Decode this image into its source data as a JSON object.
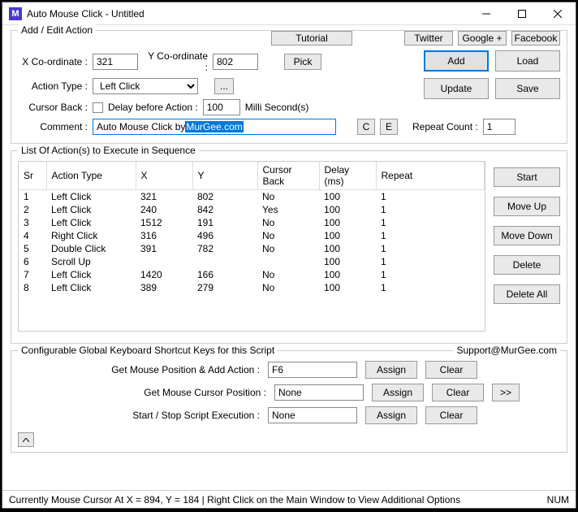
{
  "window": {
    "title": "Auto Mouse Click - Untitled"
  },
  "topbar": {
    "tutorial": "Tutorial",
    "twitter": "Twitter",
    "google": "Google +",
    "facebook": "Facebook"
  },
  "edit": {
    "title": "Add / Edit Action",
    "xcoord_label": "X Co-ordinate :",
    "xcoord": "321",
    "ycoord_label": "Y Co-ordinate :",
    "ycoord": "802",
    "pick": "Pick",
    "action_type_label": "Action Type :",
    "action_type": "Left Click",
    "cursor_back_label": "Cursor Back :",
    "delay_label": "Delay before Action :",
    "delay": "100",
    "delay_unit": "Milli Second(s)",
    "comment_label": "Comment :",
    "comment_prefix": "Auto Mouse Click by ",
    "comment_sel": "MurGee.com",
    "c": "C",
    "e": "E",
    "repeat_label": "Repeat Count :",
    "repeat": "1",
    "ellipsis": "...",
    "add": "Add",
    "load": "Load",
    "update": "Update",
    "save": "Save"
  },
  "list": {
    "title": "List Of Action(s) to Execute in Sequence",
    "start": "Start",
    "move_up": "Move Up",
    "move_down": "Move Down",
    "delete": "Delete",
    "delete_all": "Delete All",
    "headers": {
      "sr": "Sr",
      "action": "Action Type",
      "x": "X",
      "y": "Y",
      "cursor": "Cursor Back",
      "delay": "Delay (ms)",
      "repeat": "Repeat"
    },
    "rows": [
      {
        "sr": "1",
        "action": "Left Click",
        "x": "321",
        "y": "802",
        "cursor": "No",
        "delay": "100",
        "repeat": "1"
      },
      {
        "sr": "2",
        "action": "Left Click",
        "x": "240",
        "y": "842",
        "cursor": "Yes",
        "delay": "100",
        "repeat": "1"
      },
      {
        "sr": "3",
        "action": "Left Click",
        "x": "1512",
        "y": "191",
        "cursor": "No",
        "delay": "100",
        "repeat": "1"
      },
      {
        "sr": "4",
        "action": "Right Click",
        "x": "316",
        "y": "496",
        "cursor": "No",
        "delay": "100",
        "repeat": "1"
      },
      {
        "sr": "5",
        "action": "Double Click",
        "x": "391",
        "y": "782",
        "cursor": "No",
        "delay": "100",
        "repeat": "1"
      },
      {
        "sr": "6",
        "action": "Scroll Up",
        "x": "",
        "y": "",
        "cursor": "",
        "delay": "100",
        "repeat": "1"
      },
      {
        "sr": "7",
        "action": "Left Click",
        "x": "1420",
        "y": "166",
        "cursor": "No",
        "delay": "100",
        "repeat": "1"
      },
      {
        "sr": "8",
        "action": "Left Click",
        "x": "389",
        "y": "279",
        "cursor": "No",
        "delay": "100",
        "repeat": "1"
      }
    ]
  },
  "shortcuts": {
    "title": "Configurable Global Keyboard Shortcut Keys for this Script",
    "support": "Support@MurGee.com",
    "r1_label": "Get Mouse Position & Add Action :",
    "r1_val": "F6",
    "r2_label": "Get Mouse Cursor Position :",
    "r2_val": "None",
    "r3_label": "Start / Stop Script Execution :",
    "r3_val": "None",
    "assign": "Assign",
    "clear": "Clear",
    "more": ">>",
    "caret": "^"
  },
  "status": {
    "text": "Currently Mouse Cursor At X = 894, Y = 184 | Right Click on the Main Window to View Additional Options",
    "num": "NUM"
  }
}
